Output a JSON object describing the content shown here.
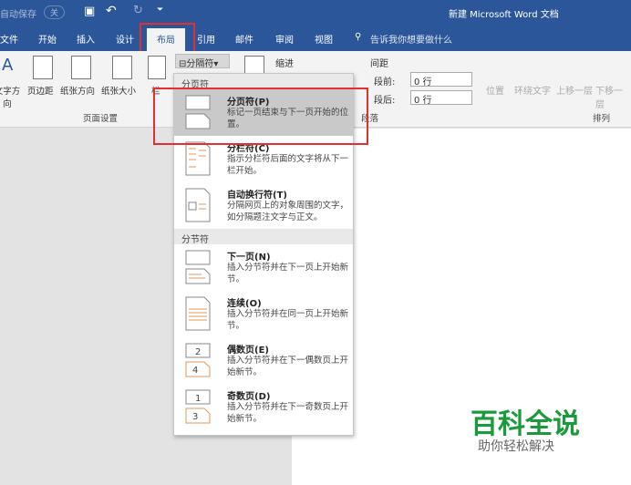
{
  "titlebar": {
    "autosave": "自动保存",
    "autosave_state": "关",
    "doc_title": "新建 Microsoft Word 文档"
  },
  "tabs": [
    "文件",
    "开始",
    "插入",
    "设计",
    "布局",
    "引用",
    "邮件",
    "审阅",
    "视图"
  ],
  "search": "告诉我你想要做什么",
  "ribbon": {
    "page_setup": [
      "文字方向",
      "页边距",
      "纸张方向",
      "纸张大小",
      "栏"
    ],
    "page_setup_label": "页面设置",
    "breaks_button": "分隔符",
    "indent_label": "缩进",
    "spacing_label": "间距",
    "before_label": "段前:",
    "before_value": "0 行",
    "after_label": "段后:",
    "after_value": "0 行",
    "paragraph_label": "段落",
    "arrange": [
      "位置",
      "环绕文字",
      "上移一层",
      "下移一层"
    ],
    "arrange_label": "排列"
  },
  "menu": {
    "page_breaks_header": "分页符",
    "section_breaks_header": "分节符",
    "page_items": [
      {
        "title": "分页符(P)",
        "desc": "标记一页结束与下一页开始的位置。"
      },
      {
        "title": "分栏符(C)",
        "desc": "指示分栏符后面的文字将从下一栏开始。"
      },
      {
        "title": "自动换行符(T)",
        "desc": "分隔网页上的对象周围的文字，如分隔题注文字与正文。"
      }
    ],
    "section_items": [
      {
        "title": "下一页(N)",
        "desc": "插入分节符并在下一页上开始新节。"
      },
      {
        "title": "连续(O)",
        "desc": "插入分节符并在同一页上开始新节。"
      },
      {
        "title": "偶数页(E)",
        "desc": "插入分节符并在下一偶数页上开始新节。"
      },
      {
        "title": "奇数页(D)",
        "desc": "插入分节符并在下一奇数页上开始新节。"
      }
    ]
  },
  "watermark": {
    "brand": "百科全说",
    "slogan": "助你轻松解决"
  },
  "colors": {
    "word_blue": "#2b579a",
    "highlight": "#e03030",
    "watermark_green": "#1a9a3a"
  }
}
